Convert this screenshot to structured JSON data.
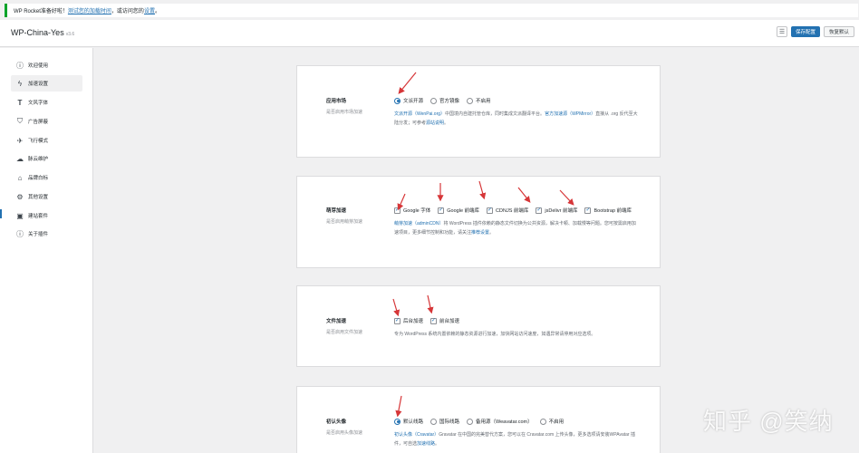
{
  "notice": {
    "text": "WP Rocket准备好啦！",
    "link1": "测试您的加载时间",
    "middle": "，或访问您的",
    "link2": "设置",
    "end": "。"
  },
  "header": {
    "title": "WP-China-Yes",
    "version": "v3.6",
    "save_label": "保存配置",
    "reset_label": "恢复默认"
  },
  "sidebar": {
    "items": [
      {
        "label": "欢迎使用",
        "icon": "info-icon"
      },
      {
        "label": "加速设置",
        "icon": "bolt-icon"
      },
      {
        "label": "文风字体",
        "icon": "text-icon"
      },
      {
        "label": "广告屏蔽",
        "icon": "shield-icon"
      },
      {
        "label": "飞行模式",
        "icon": "plane-icon"
      },
      {
        "label": "脉云维护",
        "icon": "cloud-icon"
      },
      {
        "label": "品牌白标",
        "icon": "tag-icon"
      },
      {
        "label": "其他设置",
        "icon": "gear-icon"
      },
      {
        "label": "建站套件",
        "icon": "box-icon"
      },
      {
        "label": "关于插件",
        "icon": "about-icon"
      }
    ]
  },
  "cards": {
    "store": {
      "title": "应用市场",
      "desc": "是否启用市场加速",
      "options": [
        "文派开源",
        "官方镜像",
        "不启用"
      ],
      "selected": "文派开源",
      "help_link": "文派开源（WenPai.org）",
      "help_text": "中国境内自建托管仓库，同时集成文派翻译平台。",
      "help_link2": "官方加速源（WPMirror）",
      "help_text2": "直接从 .org 反代至大陆分发；可参考",
      "help_link3": "源站说明",
      "help_end": "。"
    },
    "admin": {
      "title": "萌芽加速",
      "desc": "是否启用萌芽加速",
      "options": [
        "Google 字体",
        "Google 前端库",
        "CDNJS 前端库",
        "jsDelivr 前端库",
        "Bootstrap 前端库"
      ],
      "help_link": "萌芽加速（adminCDN）",
      "help_text": "将 WordPress 插件依赖的静态文件切换为公共资源，解决卡顿、加载慢等问题。您可按需",
      "help_text2": "启用加速项目，更多细节控制和功能，请关注",
      "help_link2": "推荐设置",
      "help_end": "。"
    },
    "files": {
      "title": "文件加速",
      "desc": "是否启用文件加速",
      "options": [
        "后台加速",
        "前台加速"
      ],
      "help_text": "专为 WordPress 系统内置依赖的静态资源进行加速，加快网站访问速度，如遇异常请停用对应选项。"
    },
    "avatar": {
      "title": "初认头像",
      "desc": "是否启用头像加速",
      "options": [
        "默认线路",
        "国际线路",
        "备用源（Weavatar.com）",
        "不启用"
      ],
      "selected": "默认线路",
      "help_link": "初认头像（Cravatar）",
      "help_text": "Gravatar 在中国的完美替代方案，您可以在 Cravatar.com 上传头像，更多选项请安装",
      "help_text2": "WPAvatar 插件，可自选",
      "help_link2": "加速线路",
      "help_end": "。"
    }
  },
  "watermark": "知乎 @笑纳",
  "colors": {
    "accent": "#2271b1",
    "arrow": "#d63638",
    "notice_border": "#00a32a"
  }
}
